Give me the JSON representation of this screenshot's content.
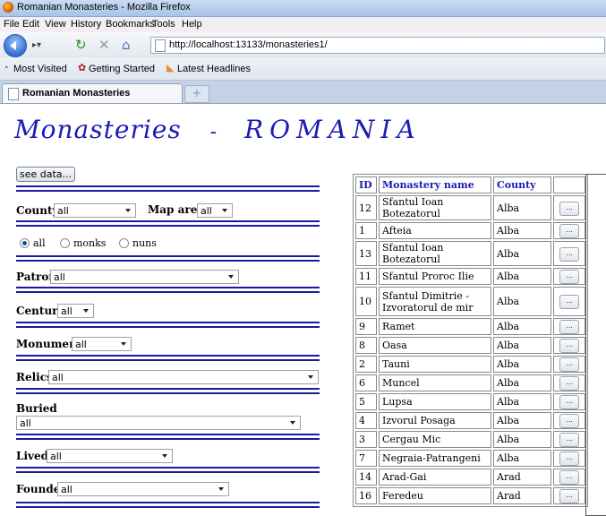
{
  "window": {
    "title": "Romanian Monasteries - Mozilla Firefox"
  },
  "menu": [
    "File",
    "Edit",
    "View",
    "History",
    "Bookmarks",
    "Tools",
    "Help"
  ],
  "url": "http://localhost:13133/monasteries1/",
  "bookmarks": [
    "Most Visited",
    "Getting Started",
    "Latest Headlines"
  ],
  "tab": {
    "title": "Romanian Monasteries",
    "new_tab": "+"
  },
  "banner": {
    "left": "Monasteries",
    "sep": "-",
    "right": "ROMANIA"
  },
  "see_button": "see data...",
  "filters": {
    "county": {
      "label": "County",
      "value": "all"
    },
    "map_area": {
      "label": "Map area",
      "value": "all"
    },
    "radios": {
      "all": "all",
      "monks": "monks",
      "nuns": "nuns",
      "selected": "all"
    },
    "patron": {
      "label": "Patron",
      "value": "all"
    },
    "century": {
      "label": "Century",
      "value": "all"
    },
    "monument": {
      "label": "Monument",
      "value": "all"
    },
    "relics": {
      "label": "Relics",
      "value": "all"
    },
    "buried": {
      "label": "Buried",
      "value": "all"
    },
    "lived": {
      "label": "Lived",
      "value": "all"
    },
    "founder": {
      "label": "Founder",
      "value": "all"
    }
  },
  "table": {
    "headers": [
      "ID",
      "Monastery name",
      "County"
    ],
    "button_label": "...",
    "rows": [
      {
        "id": "12",
        "name": "Sfantul Ioan Botezatorul",
        "county": "Alba"
      },
      {
        "id": "1",
        "name": "Afteia",
        "county": "Alba"
      },
      {
        "id": "13",
        "name": "Sfantul Ioan Botezatorul",
        "county": "Alba"
      },
      {
        "id": "11",
        "name": "Sfantul Proroc Ilie",
        "county": "Alba"
      },
      {
        "id": "10",
        "name": "Sfantul Dimitrie - Izvoratorul de mir",
        "county": "Alba"
      },
      {
        "id": "9",
        "name": "Ramet",
        "county": "Alba"
      },
      {
        "id": "8",
        "name": "Oasa",
        "county": "Alba"
      },
      {
        "id": "2",
        "name": "Tauni",
        "county": "Alba"
      },
      {
        "id": "6",
        "name": "Muncel",
        "county": "Alba"
      },
      {
        "id": "5",
        "name": "Lupsa",
        "county": "Alba"
      },
      {
        "id": "4",
        "name": "Izvorul Posaga",
        "county": "Alba"
      },
      {
        "id": "3",
        "name": "Cergau Mic",
        "county": "Alba"
      },
      {
        "id": "7",
        "name": "Negraia-Patrangeni",
        "county": "Alba"
      },
      {
        "id": "14",
        "name": "Arad-Gai",
        "county": "Arad"
      },
      {
        "id": "16",
        "name": "Feredeu",
        "county": "Arad"
      }
    ]
  }
}
